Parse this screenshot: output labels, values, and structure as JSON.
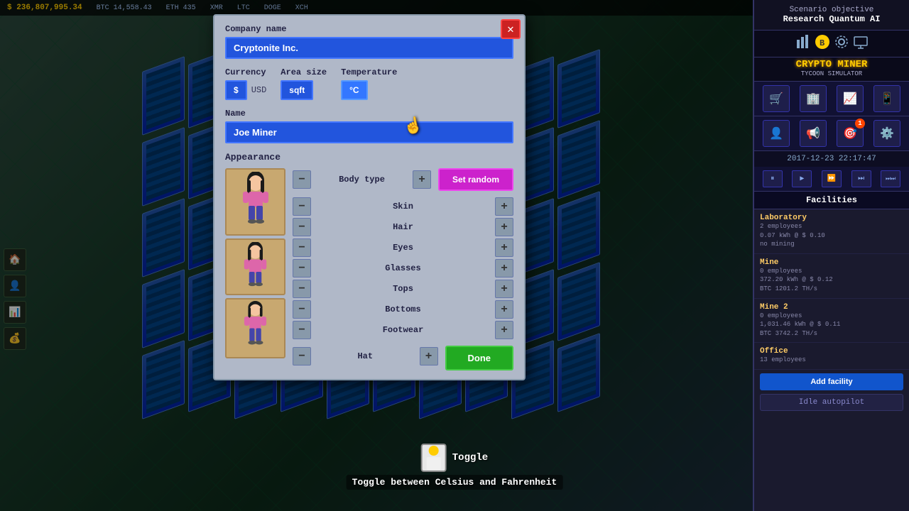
{
  "topBar": {
    "balance": "$ 236,807,995.34",
    "crypto": [
      {
        "symbol": "BTC",
        "value": "14,558.43"
      },
      {
        "symbol": "ETH",
        "value": "435"
      },
      {
        "symbol": "XMR",
        "value": ""
      },
      {
        "symbol": "LTC",
        "value": ""
      },
      {
        "symbol": "DOGE",
        "value": ""
      },
      {
        "symbol": "XCH",
        "value": ""
      }
    ]
  },
  "scenario": {
    "label": "Scenario objective",
    "title": "Research Quantum AI"
  },
  "logo": {
    "line1": "CRYPTO MINER",
    "line2": "TYCOON SIMULATOR"
  },
  "datetime": "2017-12-23 22:17:47",
  "controls": {
    "pause": "⏸",
    "play": "▶",
    "fast": "⏩",
    "faster": "⏭",
    "fastest": "⏭⏭"
  },
  "facilities": {
    "label": "Facilities",
    "items": [
      {
        "name": "Laboratory",
        "employees": "2 employees",
        "detail1": "0.07 kWh @ $ 0.10",
        "detail2": "no mining"
      },
      {
        "name": "Mine",
        "employees": "0 employees",
        "detail1": "372.20 kWh @ $ 0.12",
        "detail2": "BTC 1201.2 TH/s"
      },
      {
        "name": "Mine 2",
        "employees": "0 employees",
        "detail1": "1,031.46 kWh @ $ 0.11",
        "detail2": "BTC 3742.2 TH/s"
      },
      {
        "name": "Office",
        "employees": "13 employees",
        "detail1": "",
        "detail2": ""
      }
    ],
    "addButton": "Add facility",
    "idleButton": "Idle autopilot"
  },
  "modal": {
    "closeBtn": "✕",
    "companyNameLabel": "Company name",
    "companyNameValue": "Cryptonite Inc.",
    "currencyLabel": "Currency",
    "currencySymbol": "$",
    "currencyUnit": "USD",
    "areaSizeLabel": "Area size",
    "areaSizeValue": "sqft",
    "temperatureLabel": "Temperature",
    "temperatureValue": "°C",
    "nameLabel": "Name",
    "nameValue": "Joe Miner",
    "appearanceLabel": "Appearance",
    "setRandomBtn": "Set random",
    "attributes": [
      {
        "name": "Body type"
      },
      {
        "name": "Skin"
      },
      {
        "name": "Hair"
      },
      {
        "name": "Eyes"
      },
      {
        "name": "Glasses"
      },
      {
        "name": "Tops"
      },
      {
        "name": "Bottoms"
      },
      {
        "name": "Footwear"
      },
      {
        "name": "Hat"
      }
    ],
    "doneBtn": "Done"
  },
  "toggle": {
    "label": "Toggle",
    "description": "Toggle between Celsius and Fahrenheit"
  }
}
